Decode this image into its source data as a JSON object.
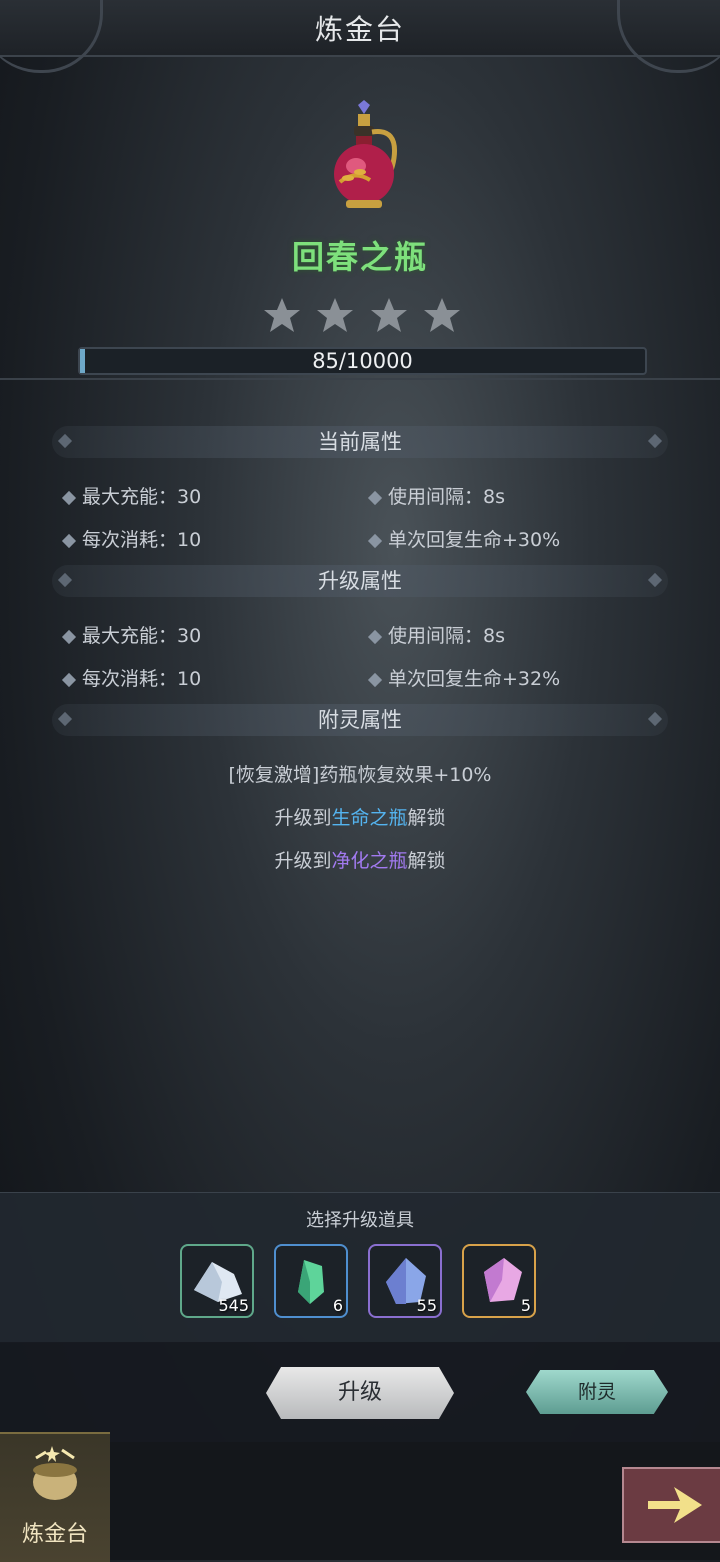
{
  "header": {
    "title": "炼金台"
  },
  "item": {
    "name": "回春之瓶",
    "stars": 4,
    "filled_stars": 0
  },
  "exp": {
    "text": "85/10000",
    "current": 85,
    "max": 10000
  },
  "sections": {
    "current": {
      "title": "当前属性",
      "left": [
        "最大充能：30",
        "每次消耗：10"
      ],
      "right": [
        "使用间隔：8s",
        "单次回复生命+30%"
      ]
    },
    "upgrade": {
      "title": "升级属性",
      "left": [
        "最大充能：30",
        "每次消耗：10"
      ],
      "right": [
        "使用间隔：8s",
        "单次回复生命+32%"
      ]
    },
    "enchant": {
      "title": "附灵属性",
      "effect": "[恢复激增]药瓶恢复效果+10%",
      "unlock1": {
        "prefix": "升级到",
        "name": "生命之瓶",
        "suffix": "解锁"
      },
      "unlock2": {
        "prefix": "升级到",
        "name": "净化之瓶",
        "suffix": "解锁"
      }
    }
  },
  "tools": {
    "title": "选择升级道具",
    "items": [
      {
        "count": "545",
        "icon": "white-crystal-icon",
        "border": "#5fa88a"
      },
      {
        "count": "6",
        "icon": "green-crystal-icon",
        "border": "#4f8fcf"
      },
      {
        "count": "55",
        "icon": "blue-crystal-icon",
        "border": "#8a6fd0"
      },
      {
        "count": "5",
        "icon": "pink-crystal-icon",
        "border": "#d8a24a"
      }
    ]
  },
  "buttons": {
    "upgrade": "升级",
    "enchant": "附灵"
  },
  "nav": {
    "tab_label": "炼金台"
  },
  "colors": {
    "item_name": "#7ee07c",
    "unlock1": "#54b4f0",
    "unlock2": "#a27af0"
  }
}
